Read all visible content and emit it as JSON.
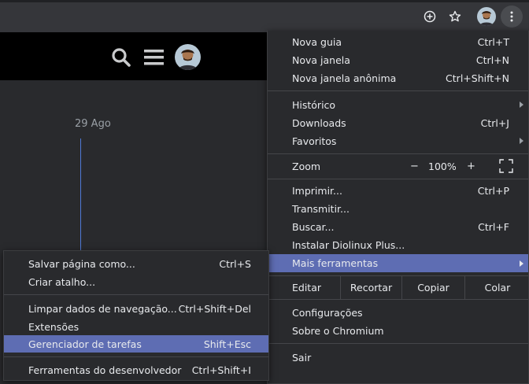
{
  "main_menu": {
    "items_group1": [
      {
        "label": "Nova guia",
        "shortcut": "Ctrl+T"
      },
      {
        "label": "Nova janela",
        "shortcut": "Ctrl+N"
      },
      {
        "label": "Nova janela anônima",
        "shortcut": "Ctrl+Shift+N"
      }
    ],
    "items_group2": [
      {
        "label": "Histórico"
      },
      {
        "label": "Downloads",
        "shortcut": "Ctrl+J"
      },
      {
        "label": "Favoritos"
      }
    ],
    "zoom": {
      "label": "Zoom",
      "minus": "−",
      "value": "100%",
      "plus": "+"
    },
    "items_group4": [
      {
        "label": "Imprimir...",
        "shortcut": "Ctrl+P"
      },
      {
        "label": "Transmitir..."
      },
      {
        "label": "Buscar...",
        "shortcut": "Ctrl+F"
      },
      {
        "label": "Instalar Diolinux Plus..."
      },
      {
        "label": "Mais ferramentas"
      }
    ],
    "edit": {
      "label": "Editar",
      "cut": "Recortar",
      "copy": "Copiar",
      "paste": "Colar"
    },
    "items_group6": [
      {
        "label": "Configurações"
      },
      {
        "label": "Sobre o Chromium"
      }
    ],
    "exit": {
      "label": "Sair"
    }
  },
  "sub_menu": {
    "items": [
      {
        "label": "Salvar página como...",
        "shortcut": "Ctrl+S"
      },
      {
        "label": "Criar atalho..."
      },
      {
        "label": "Limpar dados de navegação...",
        "shortcut": "Ctrl+Shift+Del"
      },
      {
        "label": "Extensões"
      },
      {
        "label": "Gerenciador de tarefas",
        "shortcut": "Shift+Esc"
      },
      {
        "label": "Ferramentas do desenvolvedor",
        "shortcut": "Ctrl+Shift+I"
      }
    ]
  },
  "page": {
    "date": "29 Ago"
  },
  "colors": {
    "highlight": "#5e6db3",
    "menu_bg": "#292a2d",
    "header_bg": "#000000",
    "timeline": "#4f7ad6"
  }
}
